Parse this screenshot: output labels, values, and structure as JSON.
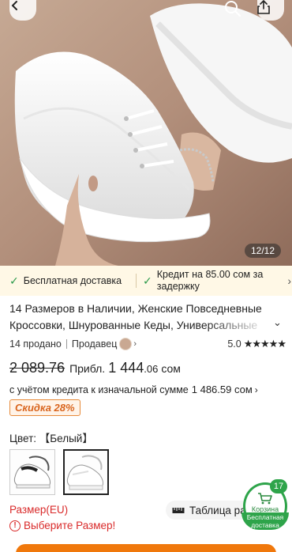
{
  "hero": {
    "image_counter": "12/12",
    "icons": {
      "back": "back-arrow-icon",
      "search": "search-icon",
      "share": "share-icon"
    }
  },
  "shipping": {
    "free_delivery": "Бесплатная доставка",
    "credit_delay": "Кредит на 85.00 сом за задержку"
  },
  "product": {
    "title": "14 Размеров в Наличии, Женские Повседневные Кроссовки, Шнурованные Кеды, Универсальные",
    "sold": "14 продано",
    "seller_label": "Продавец",
    "rating": "5.0",
    "stars": "★★★★★"
  },
  "price": {
    "old": "2 089.76",
    "approx_label": "Прибл.",
    "new_int": "1 444",
    "new_dec": ".06",
    "currency": "сом",
    "credit_text": "с учётом кредита к изначальной сумме",
    "credit_amount": "1 486.59 сом",
    "discount": "Скидка 28%"
  },
  "color": {
    "label": "Цвет:",
    "selected": "【Белый】"
  },
  "size": {
    "label": "Размер(EU)",
    "error": "Выберите Размер!",
    "table_label": "Таблица раз"
  },
  "cart": {
    "count": "17",
    "label": "Корзина",
    "free": "Бесплатная доставка"
  },
  "colors": {
    "accent": "#f0780c",
    "green": "#2ea44a",
    "error": "#d92a2a",
    "discount": "#d9651e"
  }
}
